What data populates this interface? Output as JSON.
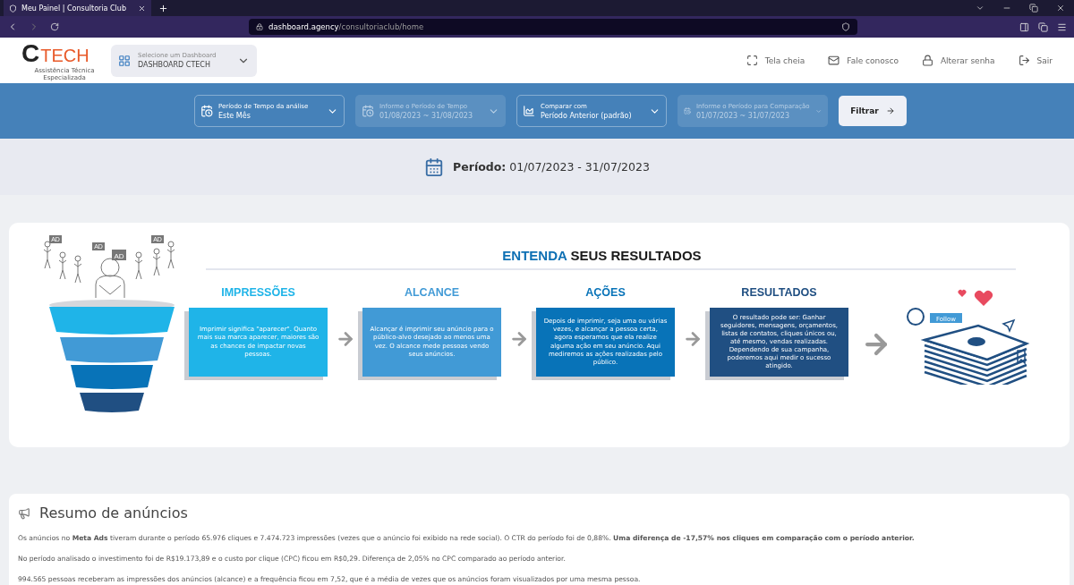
{
  "browser": {
    "tab_title": "Meu Painel | Consultoria Club",
    "url_host": "dashboard.agency",
    "url_path": "/consultoriaclub/home"
  },
  "header": {
    "logo": {
      "letter": "C",
      "word": "TECH",
      "tagline": "Assistência Técnica Especializada"
    },
    "dashboard_select": {
      "label": "Selecione um Dashboard",
      "value": "DASHBOARD CTECH"
    },
    "nav": [
      {
        "kind": "fullscreen",
        "label": "Tela cheia"
      },
      {
        "kind": "mail",
        "label": "Fale conosco"
      },
      {
        "kind": "lock",
        "label": "Alterar senha"
      },
      {
        "kind": "logout",
        "label": "Sair"
      }
    ]
  },
  "filters": [
    {
      "kind": "calendar",
      "label": "Período de Tempo da análise",
      "value": "Este Mês",
      "disabled": false
    },
    {
      "kind": "calendar",
      "label": "Informe o Período de Tempo",
      "value": "01/08/2023 ~ 31/08/2023",
      "disabled": true
    },
    {
      "kind": "chart",
      "label": "Comparar com",
      "value": "Período Anterior (padrão)",
      "disabled": false
    },
    {
      "kind": "calendar",
      "label": "Informe o Período para Comparação",
      "value": "01/07/2023 ~ 31/07/2023",
      "disabled": true
    }
  ],
  "filter_button": "Filtrar",
  "period": {
    "label": "Período:",
    "value": "01/07/2023 - 31/07/2023"
  },
  "infographic": {
    "title_highlight": "ENTENDA",
    "title_rest": "SEUS RESULTADOS",
    "ad_badges": [
      "AD",
      "AD",
      "AD",
      "AD"
    ],
    "follow_label": "Follow",
    "stages": [
      {
        "title": "IMPRESSÕES",
        "text": "Imprimir significa \"aparecer\". Quanto mais sua marca aparecer, maiores são as chances de impactar novas pessoas.",
        "color": "#1fb4e8"
      },
      {
        "title": "ALCANCE",
        "text": "Alcançar é imprimir seu anúncio para o público-alvo desejado ao menos uma vez. O alcance mede pessoas vendo seus anúncios.",
        "color": "#419ad6"
      },
      {
        "title": "AÇÕES",
        "text": "Depois de imprimir, seja uma ou várias vezes, e alcançar a pessoa certa, agora esperamos que ela realize alguma ação em seu anúncio. Aqui mediremos as ações realizadas pelo público.",
        "color": "#0873b8"
      },
      {
        "title": "RESULTADOS",
        "text": "O resultado pode ser: Ganhar seguidores, mensagens, orçamentos, listas de contatos, cliques únicos ou, até mesmo, vendas realizadas. Dependendo de sua campanha, poderemos aqui medir o sucesso atingido.",
        "color": "#204f82"
      }
    ]
  },
  "summary": {
    "title": "Resumo de anúncios",
    "paragraphs": [
      "Os anúncios no **Meta Ads** tiveram durante o período 65.976 cliques e 7.474.723 impressões (vezes que o anúncio foi exibido na rede social). O CTR do período foi de 0,88%. **Uma diferença de -17,57% nos cliques em comparação com o período anterior.**",
      "No período analisado o investimento foi de R$19.173,89 e o custo por clique (CPC) ficou em R$0,29. Diferença de 2,05% no CPC comparado ao período anterior.",
      "994.565 pessoas receberam as impressões dos anúncios (alcance) e a frequência ficou em 7,52, que é a média de vezes que os anúncios foram visualizados por uma mesma pessoa."
    ]
  }
}
